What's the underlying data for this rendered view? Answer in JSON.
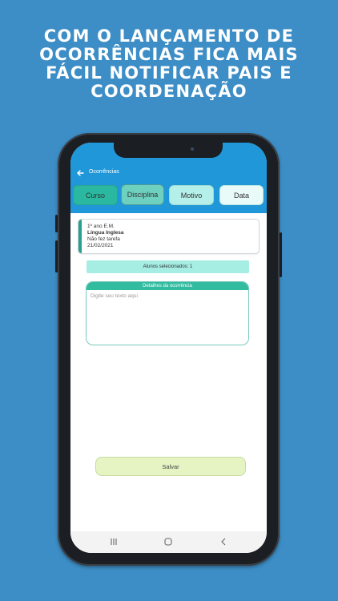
{
  "headline": {
    "lines": [
      "COM O LANÇAMENTO DE",
      "OCORRÊNCIAS FICA MAIS",
      "FÁCIL NOTIFICAR PAIS E",
      "COORDENAÇÃO"
    ]
  },
  "appbar": {
    "title": "Ocorrências",
    "back_icon": "arrow-left-icon"
  },
  "tabs": [
    {
      "label": "Curso"
    },
    {
      "label": "Disciplina"
    },
    {
      "label": "Motivo"
    },
    {
      "label": "Data"
    }
  ],
  "card": {
    "course": "1º ano E.M.",
    "subject": "Língua Inglesa",
    "reason": "Não fez tarefa",
    "date": "21/02/2021"
  },
  "selected": {
    "text": "Alunos selecionados: 1"
  },
  "details": {
    "title": "Detalhes da ocorrência",
    "placeholder": "Digite seu texto aqui",
    "value": ""
  },
  "save_label": "Salvar",
  "navbar": {
    "icons": [
      "recent-apps-icon",
      "home-icon",
      "back-nav-icon"
    ]
  },
  "colors": {
    "background": "#3d8ec6",
    "appbar": "#1f97d8",
    "accent": "#2bb8a0",
    "save": "#e6f4c4"
  }
}
